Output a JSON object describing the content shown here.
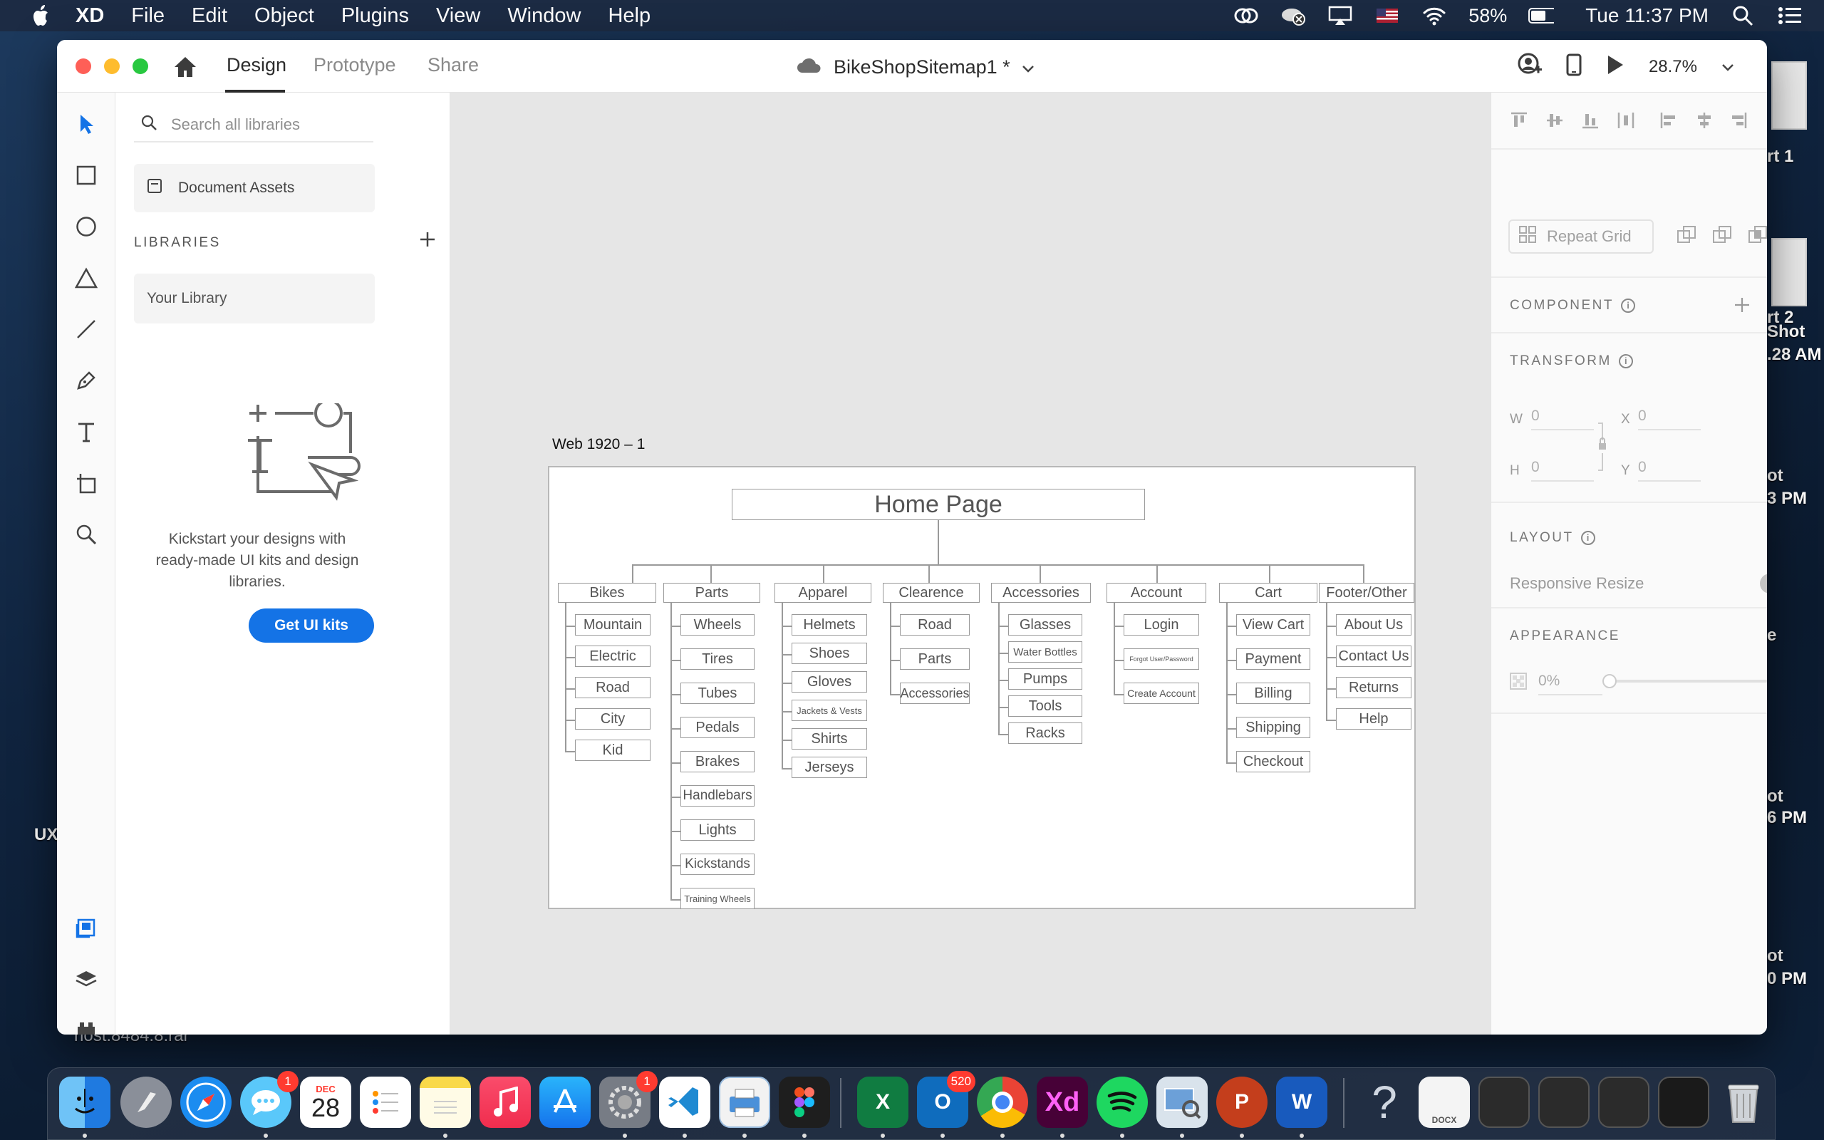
{
  "menubar": {
    "app_name": "XD",
    "items": [
      "File",
      "Edit",
      "Object",
      "Plugins",
      "View",
      "Window",
      "Help"
    ],
    "battery": "58%",
    "clock": "Tue 11:37 PM"
  },
  "window": {
    "tabs": [
      "Design",
      "Prototype",
      "Share"
    ],
    "active_tab": "Design",
    "document_title": "BikeShopSitemap1 *",
    "zoom": "28.7%"
  },
  "libraries": {
    "search_placeholder": "Search all libraries",
    "document_assets": "Document Assets",
    "heading": "LIBRARIES",
    "your_library": "Your Library",
    "kickstart_text": "Kickstart your designs with ready-made UI kits and design libraries.",
    "get_ui_kits": "Get UI kits"
  },
  "canvas": {
    "artboard_name": "Web 1920 – 1",
    "home": "Home Page",
    "sections": [
      {
        "title": "Bikes",
        "children": [
          "Mountain",
          "Electric",
          "Road",
          "City",
          "Kid"
        ]
      },
      {
        "title": "Parts",
        "children": [
          "Wheels",
          "Tires",
          "Tubes",
          "Pedals",
          "Brakes",
          "Handlebars",
          "Lights",
          "Kickstands",
          "Training Wheels"
        ]
      },
      {
        "title": "Apparel",
        "children": [
          "Helmets",
          "Shoes",
          "Gloves",
          "Jackets & Vests",
          "Shirts",
          "Jerseys"
        ]
      },
      {
        "title": "Clearence",
        "children": [
          "Road",
          "Parts",
          "Accessories"
        ]
      },
      {
        "title": "Accessories",
        "children": [
          "Glasses",
          "Water Bottles",
          "Pumps",
          "Tools",
          "Racks"
        ]
      },
      {
        "title": "Account",
        "children": [
          "Login",
          "Forgot User/Password",
          "Create Account"
        ]
      },
      {
        "title": "Cart",
        "children": [
          "View Cart",
          "Payment",
          "Billing",
          "Shipping",
          "Checkout"
        ]
      },
      {
        "title": "Footer/Other",
        "children": [
          "About Us",
          "Contact Us",
          "Returns",
          "Help"
        ]
      }
    ]
  },
  "inspector": {
    "repeat_grid": "Repeat Grid",
    "component_heading": "COMPONENT",
    "transform_heading": "TRANSFORM",
    "w_label": "W",
    "w_value": "0",
    "h_label": "H",
    "h_value": "0",
    "x_label": "X",
    "x_value": "0",
    "y_label": "Y",
    "y_value": "0",
    "layout_heading": "LAYOUT",
    "responsive_resize": "Responsive Resize",
    "appearance_heading": "APPEARANCE",
    "opacity": "0%"
  },
  "desktop": {
    "labels": [
      "UX",
      "host.8484.8.rar",
      "rt 1",
      "rt 2",
      "Shot",
      ".28 AM",
      "ot",
      "3 PM",
      "e",
      "ot",
      "6 PM",
      "ot",
      "0 PM"
    ]
  },
  "dock": {
    "calendar_month": "DEC",
    "calendar_day": "28",
    "badges": {
      "messages": "1",
      "system_prefs": "1",
      "outlook": "520"
    },
    "docx_label": "DOCX",
    "help_glyph": "?",
    "app_labels": {
      "xd": "Xd"
    }
  }
}
